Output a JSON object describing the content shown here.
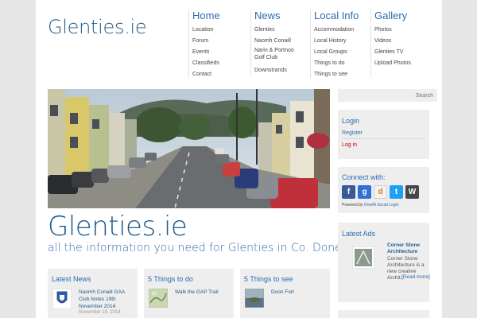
{
  "header": {
    "logo": "Glenties.ie"
  },
  "nav": [
    {
      "head": "Home",
      "items": [
        "Location",
        "Forum",
        "Events",
        "Classifieds",
        "Contact"
      ]
    },
    {
      "head": "News",
      "items": [
        "Glenties",
        "Naomh Conaill",
        "Narin & Portnoo Golf Club",
        "Downstrands"
      ]
    },
    {
      "head": "Local Info",
      "items": [
        "Accommodation",
        "Local History",
        "Local Groups",
        "Things to do",
        "Things to see"
      ]
    },
    {
      "head": "Gallery",
      "items": [
        "Photos",
        "Videos",
        "Glenties TV",
        "Upload Photos"
      ]
    }
  ],
  "hero": {
    "title": "Glenties.ie",
    "tagline": "all the information you need for Glenties in Co. Donegal"
  },
  "boxes": {
    "news": {
      "title": "Latest News",
      "entry": "Naomh Conaill GAA Club Notes 19th November 2014",
      "date": "November 19, 2014"
    },
    "todo": {
      "title": "5 Things to do",
      "entry": "Walk the GAP Trail"
    },
    "see": {
      "title": "5 Things to see",
      "entry": "Doon Fort"
    }
  },
  "sidebar": {
    "search_placeholder": "Search",
    "login": {
      "title": "Login",
      "register": "Register",
      "login_link": "Log in"
    },
    "connect": {
      "title": "Connect with:",
      "icons": [
        "facebook-icon",
        "google-icon",
        "digg-icon",
        "twitter-icon",
        "wordpress-icon"
      ],
      "icon_glyphs": [
        "f",
        "g",
        "d",
        "t",
        "W"
      ],
      "powered_prefix": "Powered by",
      "powered_link": "OneAll Social Login"
    },
    "ads": {
      "title": "Latest Ads",
      "ad_title": "Corner Stone Architecture",
      "ad_body": "Corner Stone Architecture is a new creative Archit...",
      "read_more": "[Read more]"
    }
  },
  "colors": {
    "accent": "#1e5a8a",
    "link": "#2b6cb0",
    "login_red": "#cc0000",
    "panel": "#eeeeee"
  }
}
